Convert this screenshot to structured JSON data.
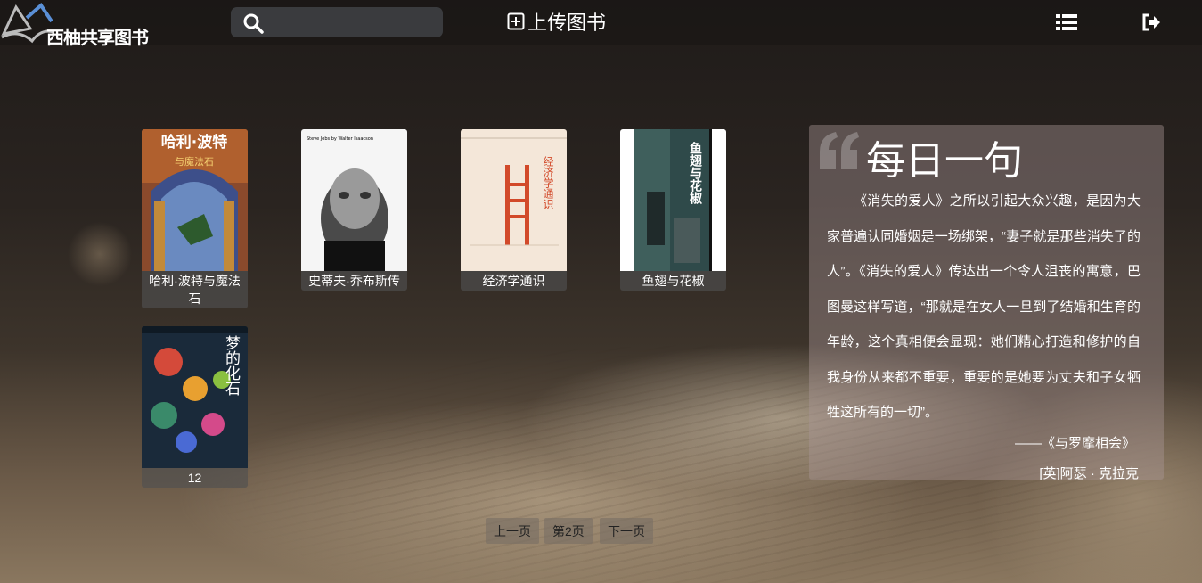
{
  "header": {
    "logo_text": "西柚共享图书",
    "search": {
      "value": "",
      "placeholder": ""
    },
    "upload_label": "上传图书"
  },
  "books": [
    {
      "title": "哈利·波特与魔法石",
      "cover_text": "哈利·波特",
      "cover_sub": "与魔法石"
    },
    {
      "title": "史蒂夫·乔布斯传",
      "cover_text": "Steve Jobs by Walter Isaacson"
    },
    {
      "title": "经济学通识",
      "cover_text": "经济学通识"
    },
    {
      "title": "鱼翅与花椒",
      "cover_text": "鱼翅与花椒"
    },
    {
      "title": "12",
      "cover_text": "梦的化石"
    }
  ],
  "quote": {
    "heading": "每日一句",
    "body": "《消失的爱人》之所以引起大众兴趣，是因为大家普遍认同婚姻是一场绑架，“妻子就是那些消失了的人”。《消失的爱人》传达出一个令人沮丧的寓意，巴图曼这样写道，“那就是在女人一旦到了结婚和生育的年龄，这个真相便会显现：她们精心打造和修护的自我身份从来都不重要，重要的是她要为丈夫和子女牺牲这所有的一切”。",
    "source": "——《与罗摩相会》",
    "author": "[英]阿瑟 · 克拉克"
  },
  "pagination": {
    "prev": "上一页",
    "current": "第2页",
    "next": "下一页"
  },
  "colors": {
    "quote_panel": "#a89696",
    "pager_button": "#786e64",
    "search_bg": "#3a3b3e"
  }
}
